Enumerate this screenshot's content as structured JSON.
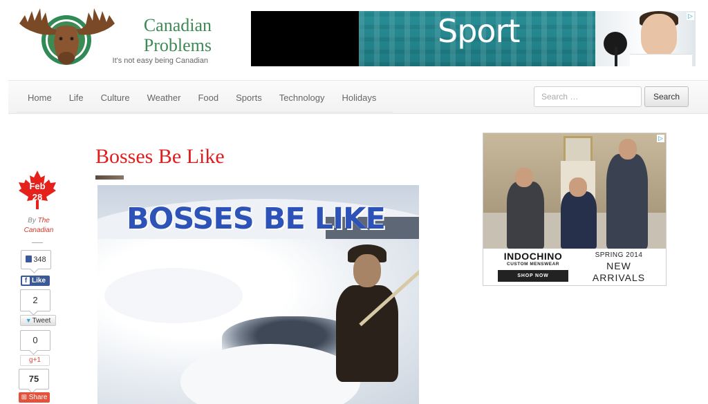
{
  "site": {
    "title_line1": "Canadian",
    "title_line2": "Problems",
    "tagline": "It's not easy being Canadian"
  },
  "top_ad": {
    "headline": "Sport"
  },
  "nav": {
    "items": [
      "Home",
      "Life",
      "Culture",
      "Weather",
      "Food",
      "Sports",
      "Technology",
      "Holidays"
    ]
  },
  "search": {
    "placeholder": "Search …",
    "button_label": "Search"
  },
  "post": {
    "title": "Bosses Be Like",
    "date_month": "Feb",
    "date_day": "28",
    "byline_prefix": "By",
    "author": "The Canadian",
    "image_caption": "BOSSES BE LIKE"
  },
  "social": {
    "facebook_count": "348",
    "facebook_label": "Like",
    "twitter_count": "2",
    "twitter_label": "Tweet",
    "gplus_count": "0",
    "gplus_label": "+1",
    "share_count": "75",
    "share_label": "Share"
  },
  "side_ad": {
    "brand": "INDOCHINO",
    "subtitle": "CUSTOM MENSWEAR",
    "cta": "SHOP NOW",
    "season": "SPRING 2014",
    "line1": "NEW",
    "line2": "ARRIVALS"
  },
  "colors": {
    "title_red": "#e11d1d",
    "brand_green": "#3e8a55",
    "facebook_blue": "#3b5998",
    "share_red": "#e3523d"
  }
}
